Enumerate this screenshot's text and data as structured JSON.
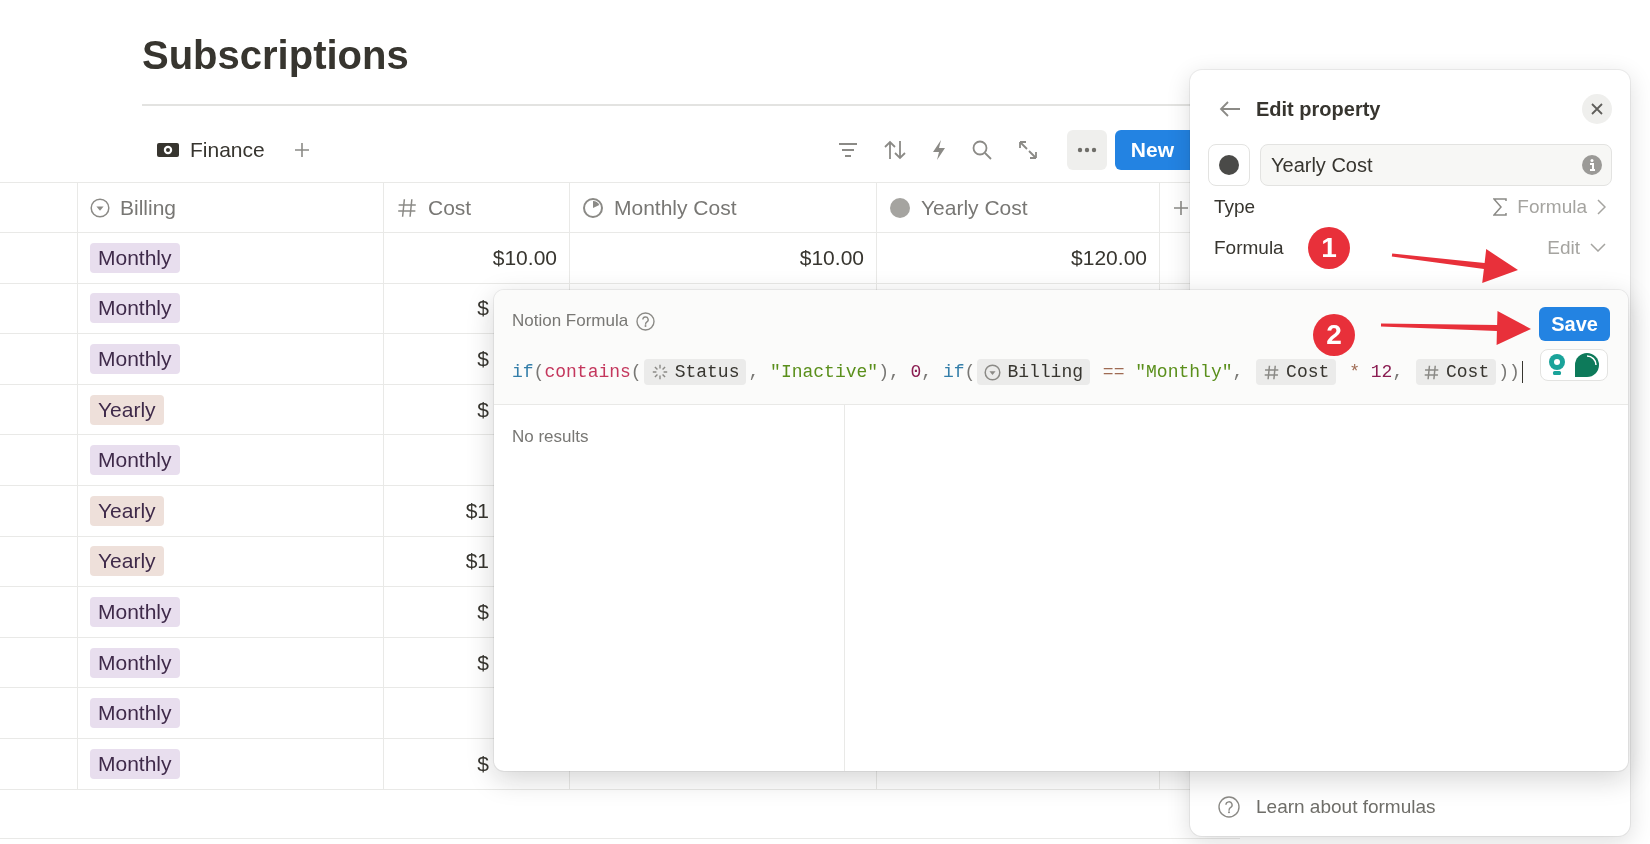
{
  "page": {
    "title": "Subscriptions"
  },
  "view_tabs": [
    {
      "label": "Finance"
    }
  ],
  "toolbar": {
    "new_button": "New"
  },
  "table": {
    "columns": [
      {
        "label": "Billing",
        "kind": "select"
      },
      {
        "label": "Cost",
        "kind": "number"
      },
      {
        "label": "Monthly Cost",
        "kind": "progress"
      },
      {
        "label": "Yearly Cost",
        "kind": "dot"
      }
    ],
    "rows": [
      {
        "billing": {
          "text": "Monthly",
          "color": "#e8deee"
        },
        "cost": "$10.00",
        "monthly_cost": "$10.00",
        "yearly_cost": "$120.00"
      },
      {
        "billing": {
          "text": "Monthly",
          "color": "#e8deee"
        },
        "cost": "$"
      },
      {
        "billing": {
          "text": "Monthly",
          "color": "#e8deee"
        },
        "cost": "$"
      },
      {
        "billing": {
          "text": "Yearly",
          "color": "#eee0da"
        },
        "cost": "$"
      },
      {
        "billing": {
          "text": "Monthly",
          "color": "#e8deee"
        }
      },
      {
        "billing": {
          "text": "Yearly",
          "color": "#eee0da"
        },
        "cost": "$1"
      },
      {
        "billing": {
          "text": "Yearly",
          "color": "#eee0da"
        },
        "cost": "$1"
      },
      {
        "billing": {
          "text": "Monthly",
          "color": "#e8deee"
        },
        "cost": "$"
      },
      {
        "billing": {
          "text": "Monthly",
          "color": "#e8deee"
        },
        "cost": "$"
      },
      {
        "billing": {
          "text": "Monthly",
          "color": "#e8deee"
        }
      },
      {
        "billing": {
          "text": "Monthly",
          "color": "#e8deee"
        },
        "cost": "$"
      }
    ]
  },
  "property_panel": {
    "title": "Edit property",
    "name_value": "Yearly Cost",
    "rows": [
      {
        "label": "Type",
        "value": "Formula",
        "kind": "menu"
      },
      {
        "label": "Formula",
        "value": "Edit",
        "kind": "dropdown"
      }
    ],
    "footer_link": "Learn about formulas"
  },
  "formula_editor": {
    "title": "Notion Formula",
    "save_button": "Save",
    "results_message": "No results",
    "tokens": [
      {
        "kind": "keyword",
        "text": "if"
      },
      {
        "kind": "punct",
        "text": "("
      },
      {
        "kind": "func",
        "text": "contains"
      },
      {
        "kind": "punct",
        "text": "("
      },
      {
        "kind": "prop",
        "text": "Status"
      },
      {
        "kind": "punct",
        "text": ","
      },
      {
        "kind": "string",
        "text": "\"Inactive\""
      },
      {
        "kind": "punct",
        "text": "),"
      },
      {
        "kind": "number",
        "text": "0"
      },
      {
        "kind": "punct",
        "text": ","
      },
      {
        "kind": "keyword",
        "text": "if"
      },
      {
        "kind": "punct",
        "text": "("
      },
      {
        "kind": "prop",
        "text": "Billing"
      },
      {
        "kind": "op",
        "text": "=="
      },
      {
        "kind": "string",
        "text": "\"Monthly\""
      },
      {
        "kind": "punct",
        "text": ","
      },
      {
        "kind": "prop",
        "text": "Cost"
      },
      {
        "kind": "op",
        "text": "*"
      },
      {
        "kind": "number",
        "text": "12"
      },
      {
        "kind": "punct",
        "text": ","
      },
      {
        "kind": "prop",
        "text": "Cost"
      },
      {
        "kind": "punct",
        "text": "))"
      }
    ]
  },
  "annotations": [
    {
      "label": "1"
    },
    {
      "label": "2"
    }
  ]
}
